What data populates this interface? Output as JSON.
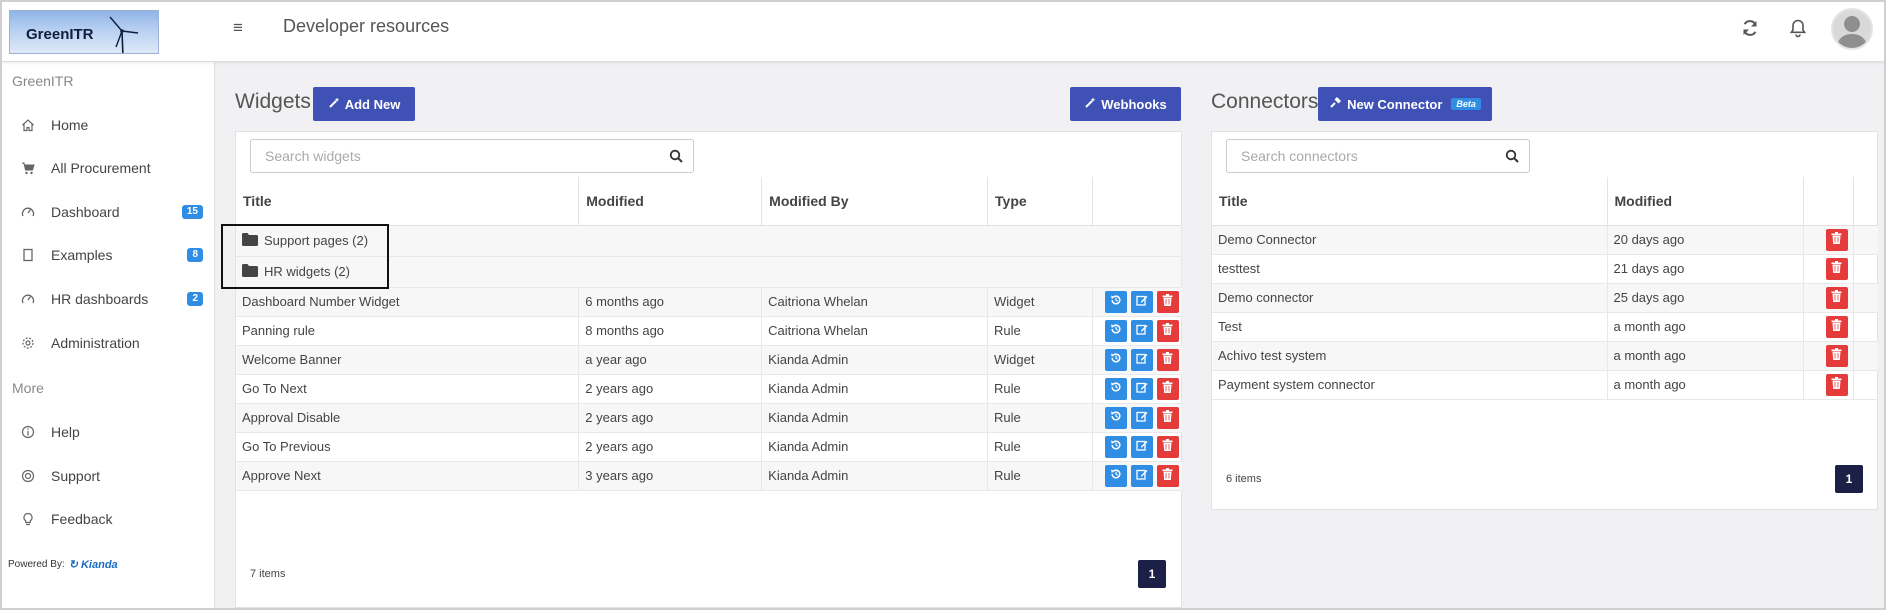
{
  "header": {
    "logo_text": "GreenITR",
    "title": "Developer resources"
  },
  "sidebar": {
    "section_main": "GreenITR",
    "items": [
      {
        "label": "Home",
        "icon": "home-icon"
      },
      {
        "label": "All Procurement",
        "icon": "cart-icon"
      },
      {
        "label": "Dashboard",
        "icon": "gauge-icon",
        "badge": "15"
      },
      {
        "label": "Examples",
        "icon": "book-icon",
        "badge": "8"
      },
      {
        "label": "HR dashboards",
        "icon": "gauge-icon",
        "badge": "2"
      },
      {
        "label": "Administration",
        "icon": "gear-icon"
      }
    ],
    "section_more": "More",
    "more_items": [
      {
        "label": "Help",
        "icon": "info-icon"
      },
      {
        "label": "Support",
        "icon": "lifebuoy-icon"
      },
      {
        "label": "Feedback",
        "icon": "lightbulb-icon"
      }
    ],
    "powered_by": "Powered By:",
    "powered_brand": "Kianda"
  },
  "widgets": {
    "title": "Widgets",
    "add_label": "Add New",
    "webhooks_label": "Webhooks",
    "search_placeholder": "Search widgets",
    "columns": [
      "Title",
      "Modified",
      "Modified By",
      "Type"
    ],
    "folders": [
      {
        "label": "Support pages (2)"
      },
      {
        "label": "HR widgets (2)"
      }
    ],
    "rows": [
      {
        "title": "Dashboard Number Widget",
        "modified": "6 months ago",
        "by": "Caitriona Whelan",
        "type": "Widget"
      },
      {
        "title": "Panning rule",
        "modified": "8 months ago",
        "by": "Caitriona Whelan",
        "type": "Rule"
      },
      {
        "title": "Welcome Banner",
        "modified": "a year ago",
        "by": "Kianda Admin",
        "type": "Widget"
      },
      {
        "title": "Go To Next",
        "modified": "2 years ago",
        "by": "Kianda Admin",
        "type": "Rule"
      },
      {
        "title": "Approval Disable",
        "modified": "2 years ago",
        "by": "Kianda Admin",
        "type": "Rule"
      },
      {
        "title": "Go To Previous",
        "modified": "2 years ago",
        "by": "Kianda Admin",
        "type": "Rule"
      },
      {
        "title": "Approve Next",
        "modified": "3 years ago",
        "by": "Kianda Admin",
        "type": "Rule"
      }
    ],
    "count": "7 items",
    "page": "1"
  },
  "connectors": {
    "title": "Connectors",
    "new_label": "New Connector",
    "beta": "Beta",
    "search_placeholder": "Search connectors",
    "columns": [
      "Title",
      "Modified"
    ],
    "rows": [
      {
        "title": "Demo Connector",
        "modified": "20 days ago"
      },
      {
        "title": "testtest",
        "modified": "21 days ago"
      },
      {
        "title": "Demo connector",
        "modified": "25 days ago"
      },
      {
        "title": "Test",
        "modified": "a month ago"
      },
      {
        "title": "Achivo test system",
        "modified": "a month ago"
      },
      {
        "title": "Payment system connector",
        "modified": "a month ago"
      }
    ],
    "count": "6 items",
    "page": "1"
  },
  "colors": {
    "primary": "#3f51b5",
    "action_blue": "#2f8de4",
    "action_red": "#e63b3b",
    "pager": "#1c2046"
  }
}
